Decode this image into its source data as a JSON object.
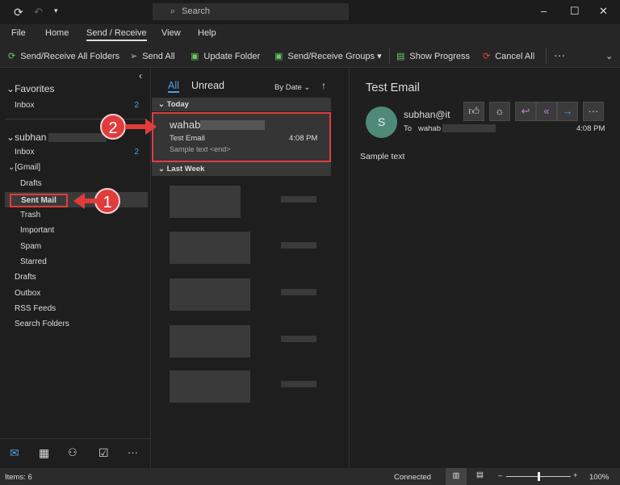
{
  "titlebar": {
    "search_placeholder": "Search"
  },
  "menu": {
    "tabs": [
      "File",
      "Home",
      "Send / Receive",
      "View",
      "Help"
    ],
    "active": "Send / Receive"
  },
  "ribbon": {
    "send_receive_all": "Send/Receive All Folders",
    "send_all": "Send All",
    "update_folder": "Update Folder",
    "send_receive_groups": "Send/Receive Groups",
    "show_progress": "Show Progress",
    "cancel_all": "Cancel All",
    "more": "···"
  },
  "folders": {
    "favorites": {
      "label": "Favorites",
      "inbox": "Inbox",
      "inbox_count": "2"
    },
    "account": {
      "label": "subhan",
      "inbox": "Inbox",
      "inbox_count": "2",
      "gmail": "[Gmail]",
      "gmail_items": [
        "Drafts",
        "Sent Mail",
        "Trash",
        "Important",
        "Spam",
        "Starred"
      ],
      "other_items": [
        "Drafts",
        "Outbox",
        "RSS Feeds",
        "Search Folders"
      ]
    }
  },
  "list": {
    "filter_all": "All",
    "filter_unread": "Unread",
    "sort": "By Date",
    "sort_dir": "↑",
    "groups": {
      "today": "Today",
      "last_week": "Last Week"
    },
    "selected": {
      "from": "wahab",
      "subject": "Test Email",
      "time": "4:08 PM",
      "preview": "Sample text <end>"
    }
  },
  "reading": {
    "subject": "Test Email",
    "avatar_initial": "S",
    "avatar_color": "#4f8a78",
    "from": "subhan@it",
    "to_label": "To",
    "to": "wahab",
    "time": "4:08 PM",
    "body": "Sample text"
  },
  "callouts": {
    "one": "1",
    "two": "2"
  },
  "status": {
    "items": "Items: 6",
    "connection": "Connected",
    "zoom": "100%",
    "zoom_level": 100
  },
  "colors": {
    "accent": "#4ba3e3",
    "highlight": "#e03c3c"
  }
}
